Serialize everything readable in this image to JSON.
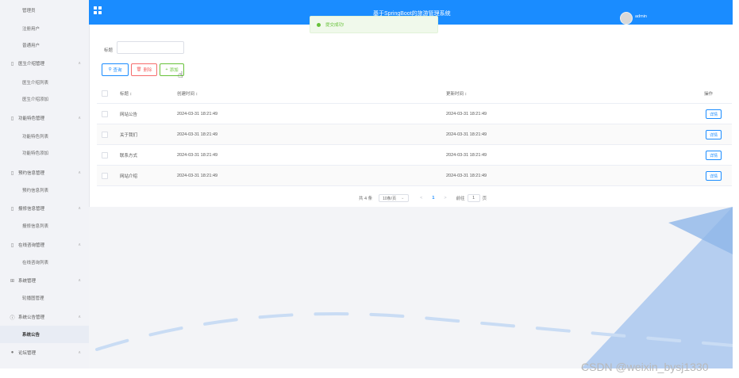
{
  "header": {
    "title": "基于SpringBoot的旅游管理系统",
    "user": "admin"
  },
  "toast": {
    "message": "提交成功!"
  },
  "sidebar": {
    "items": [
      {
        "label": "管理员",
        "type": "sub"
      },
      {
        "label": "注册用户",
        "type": "sub"
      },
      {
        "label": "普通用户",
        "type": "sub"
      },
      {
        "label": "医生介绍管理",
        "type": "group",
        "icon": "file-icon"
      },
      {
        "label": "医生介绍列表",
        "type": "sub"
      },
      {
        "label": "医生介绍添加",
        "type": "sub"
      },
      {
        "label": "功能特色管理",
        "type": "group",
        "icon": "file-icon"
      },
      {
        "label": "功能特色列表",
        "type": "sub"
      },
      {
        "label": "功能特色添加",
        "type": "sub"
      },
      {
        "label": "预约信息管理",
        "type": "group",
        "icon": "file-icon"
      },
      {
        "label": "预约信息列表",
        "type": "sub"
      },
      {
        "label": "报修信息管理",
        "type": "group",
        "icon": "file-icon"
      },
      {
        "label": "报修信息列表",
        "type": "sub"
      },
      {
        "label": "在线咨询管理",
        "type": "group",
        "icon": "file-icon"
      },
      {
        "label": "在线咨询列表",
        "type": "sub"
      },
      {
        "label": "系统管理",
        "type": "group",
        "icon": "grid-box-icon"
      },
      {
        "label": "轮播图管理",
        "type": "sub"
      },
      {
        "label": "系统公告管理",
        "type": "group",
        "icon": "info-circle-icon"
      },
      {
        "label": "系统公告",
        "type": "sub",
        "active": true
      },
      {
        "label": "论坛管理",
        "type": "group",
        "icon": "location-pin-icon"
      }
    ]
  },
  "search": {
    "label": "标题",
    "placeholder": ""
  },
  "toolbar": {
    "search_label": "查询",
    "delete_label": "删除",
    "add_label": "添加"
  },
  "table": {
    "columns": {
      "title": "标题 ↕",
      "created": "创建时间 ↕",
      "updated": "更新时间 ↕",
      "action": "操作"
    },
    "rows": [
      {
        "title": "网站公告",
        "created": "2024-03-31 18:21:49",
        "updated": "2024-03-31 18:21:49",
        "action": "详情"
      },
      {
        "title": "关于我们",
        "created": "2024-03-31 18:21:49",
        "updated": "2024-03-31 18:21:49",
        "action": "详情"
      },
      {
        "title": "联系方式",
        "created": "2024-03-31 18:21:49",
        "updated": "2024-03-31 18:21:49",
        "action": "详情"
      },
      {
        "title": "网站介绍",
        "created": "2024-03-31 18:21:49",
        "updated": "2024-03-31 18:21:49",
        "action": "详情"
      }
    ]
  },
  "pagination": {
    "total": "共 4 条",
    "page_size": "10条/页",
    "prev": "<",
    "current": "1",
    "next": ">",
    "goto_label": "前往",
    "goto_value": "1",
    "goto_suffix": "页"
  },
  "watermark": "CSDN @weixin_bysj1330",
  "colors": {
    "primary": "#1a8cff",
    "danger": "#f56c6c",
    "success": "#67c23a",
    "sidebar_bg": "#f2f3f7"
  }
}
